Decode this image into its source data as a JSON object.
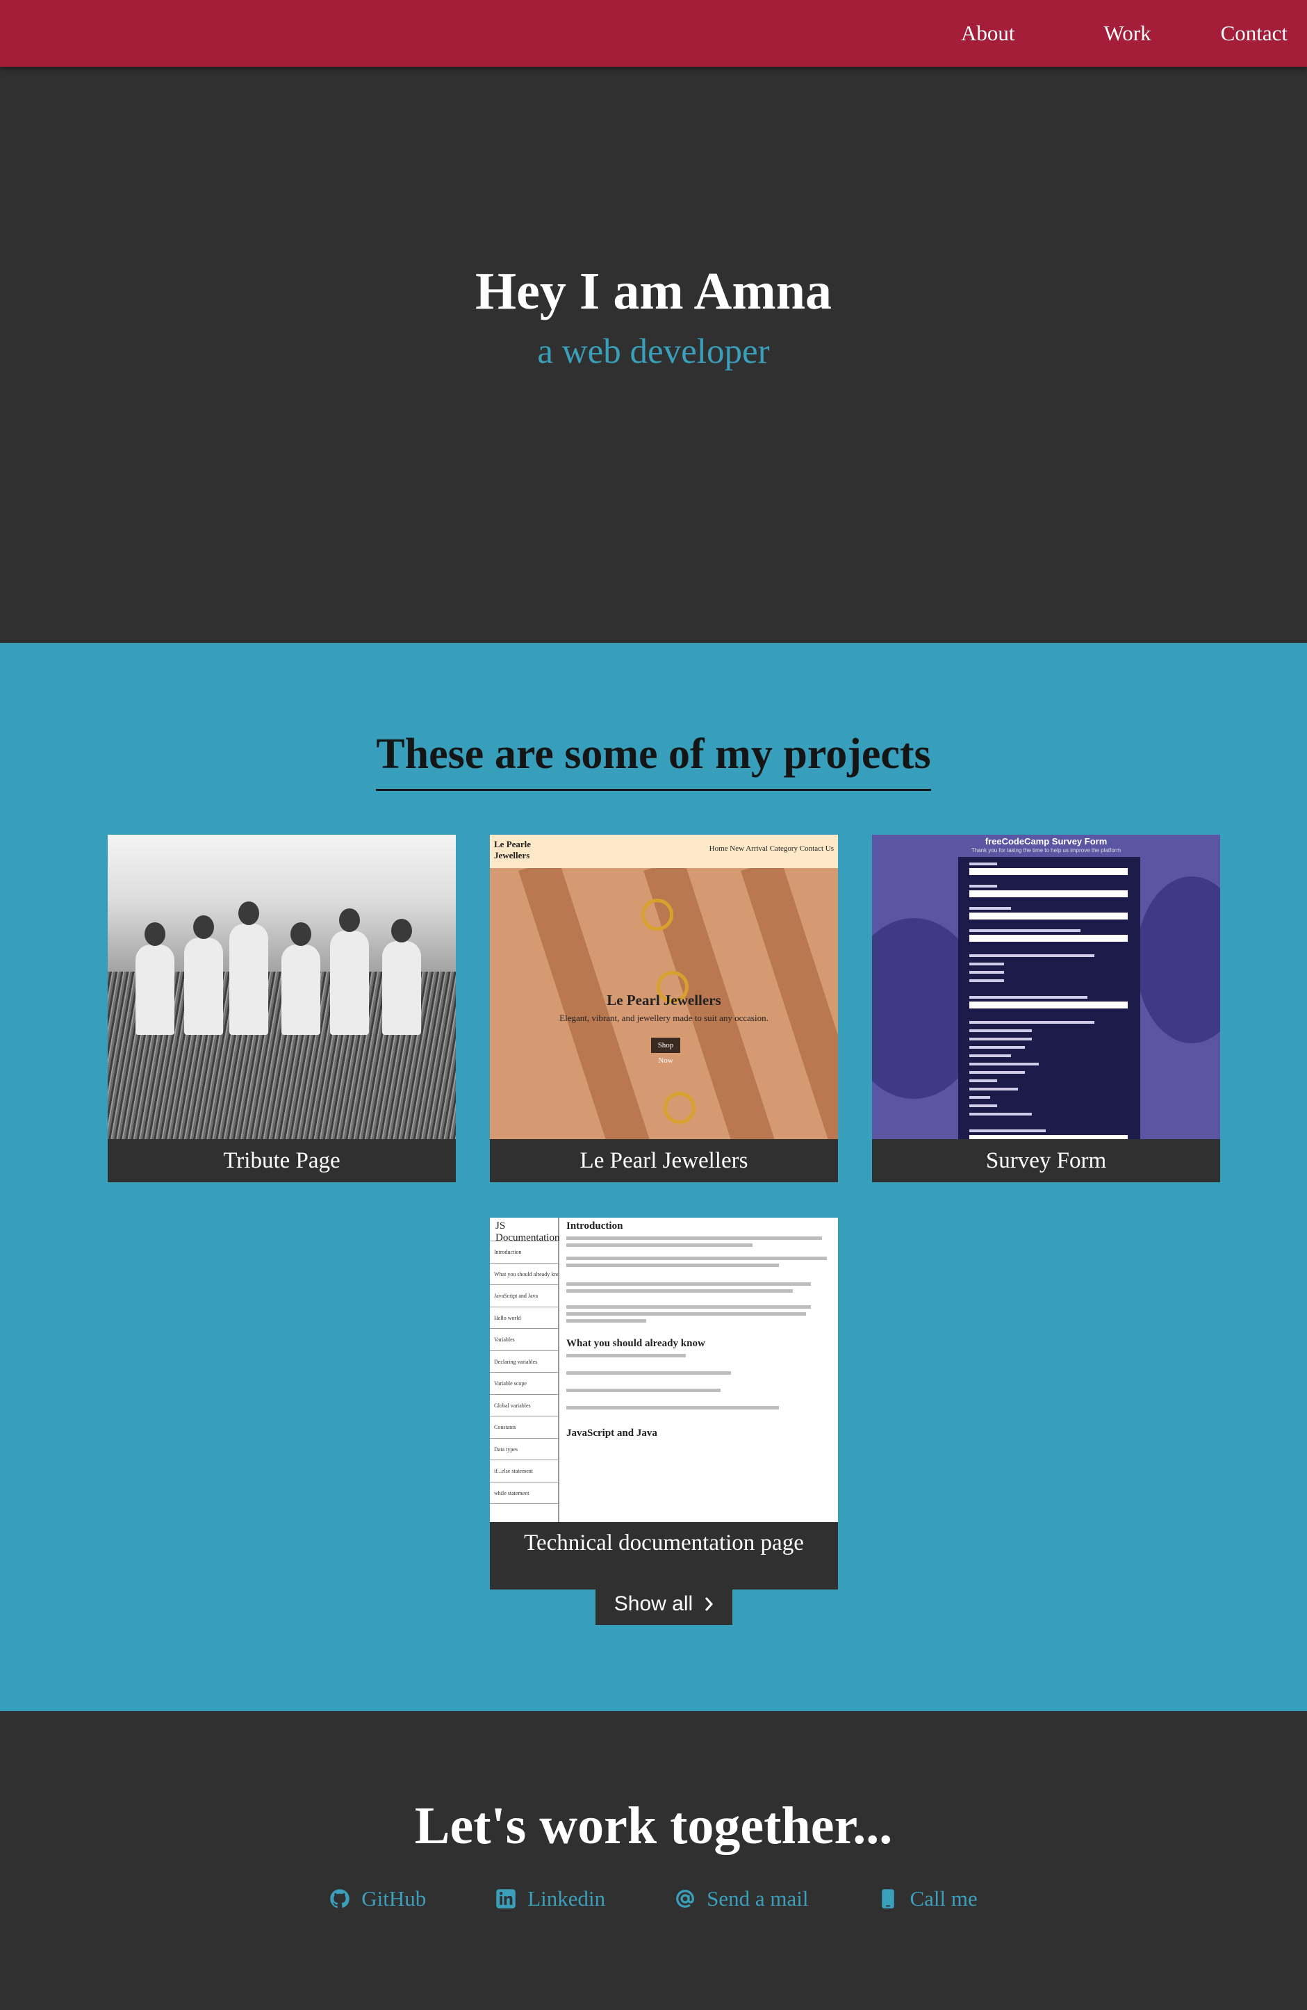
{
  "nav": {
    "items": [
      {
        "label": "About"
      },
      {
        "label": "Work"
      },
      {
        "label": "Contact"
      }
    ]
  },
  "hero": {
    "title": "Hey I am Amna",
    "subtitle": "a web developer"
  },
  "projects": {
    "heading": "These are some of my projects",
    "items": [
      {
        "title": "Tribute Page"
      },
      {
        "title": "Le Pearl Jewellers",
        "thumb": {
          "logo": "Le Pearle Jewellers",
          "nav": "Home   New Arrival   Category   Contact Us",
          "heading": "Le Pearl Jewellers",
          "tagline": "Elegant, vibrant, and jewellery made to suit any occasion.",
          "button": "Shop Now"
        }
      },
      {
        "title": "Survey Form",
        "thumb": {
          "heading": "freeCodeCamp Survey Form",
          "sub": "Thank you for taking the time to help us improve the platform"
        }
      },
      {
        "title": "Technical documentation page",
        "thumb": {
          "nav_title": "JS Documentation",
          "nav_items": [
            "Introduction",
            "What you should already know",
            "JavaScript and Java",
            "Hello world",
            "Variables",
            "Declaring variables",
            "Variable scope",
            "Global variables",
            "Constants",
            "Data types",
            "if...else statement",
            "while statement"
          ],
          "h1": "Introduction",
          "h2": "What you should already know",
          "h3": "JavaScript and Java"
        }
      }
    ],
    "show_all": "Show all"
  },
  "contact": {
    "heading": "Let's work together...",
    "links": [
      {
        "label": "GitHub",
        "icon": "github-icon"
      },
      {
        "label": "Linkedin",
        "icon": "linkedin-icon"
      },
      {
        "label": "Send a mail",
        "icon": "at-icon"
      },
      {
        "label": "Call me",
        "icon": "phone-icon"
      }
    ]
  },
  "colors": {
    "nav_bg": "#a41d39",
    "dark_bg": "#303030",
    "accent": "#3a9fbb",
    "projects_bg": "#379ebb"
  }
}
